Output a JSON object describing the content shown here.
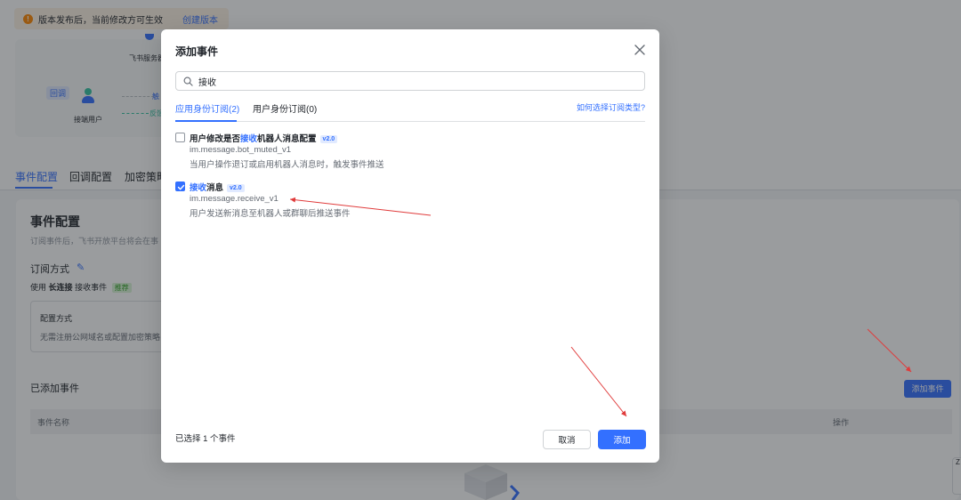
{
  "background": {
    "notice": {
      "text": "版本发布后，当前修改方可生效",
      "link": "创建版本"
    },
    "flow": {
      "callback_tag": "回调",
      "user_label": "接端用户",
      "service_label": "飞书服务器",
      "tag_top": "触",
      "tag_bottom": "反馈"
    },
    "tabs": [
      "事件配置",
      "回调配置",
      "加密策略"
    ],
    "section_title": "事件配置",
    "section_desc": "订阅事件后，飞书开放平台将会在事",
    "subscribe_title": "订阅方式",
    "usage": {
      "prefix": "使用",
      "method": "长连接",
      "suffix": "接收事件",
      "tag": "推荐"
    },
    "config_box": {
      "title": "配置方式",
      "desc": "无需注册公网域名或配置加密策略"
    },
    "added_title": "已添加事件",
    "add_event_button": "添加事件",
    "table": {
      "col_name": "事件名称",
      "col_action": "操作"
    },
    "side_float": "Z"
  },
  "modal": {
    "title": "添加事件",
    "search": {
      "value": "接收",
      "placeholder": ""
    },
    "tabs": [
      {
        "label": "应用身份订阅(2)",
        "active": true
      },
      {
        "label": "用户身份订阅(0)",
        "active": false
      }
    ],
    "help_link": "如何选择订阅类型?",
    "events": [
      {
        "title_before": "用户修改是否",
        "title_highlight": "接收",
        "title_after": "机器人消息配置",
        "version": "v2.0",
        "key": "im.message.bot_muted_v1",
        "desc": "当用户操作退订或启用机器人消息时，触发事件推送",
        "checked": false
      },
      {
        "title_before": "",
        "title_highlight": "接收",
        "title_after": "消息",
        "version": "v2.0",
        "key": "im.message.receive_v1",
        "desc": "用户发送新消息至机器人或群聊后推送事件",
        "checked": true
      }
    ],
    "selected_count": "已选择 1 个事件",
    "cancel": "取消",
    "confirm": "添加"
  },
  "colors": {
    "primary": "#3370ff",
    "annotation": "#e03b3b",
    "mask": "rgba(31,35,41,0.45)"
  },
  "icons": {
    "close": "close-icon",
    "search": "search-icon",
    "check": "check-icon",
    "warning": "warning-icon",
    "edit": "edit-icon"
  }
}
